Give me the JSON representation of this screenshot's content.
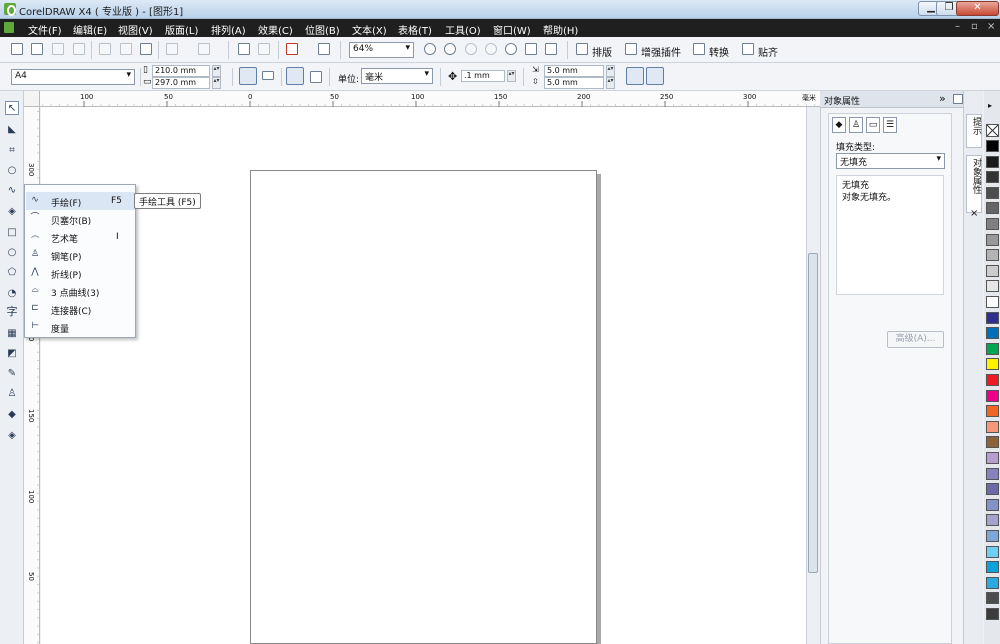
{
  "window": {
    "title": "CorelDRAW X4 ( 专业版 ) - [图形1]",
    "controls": [
      "▁",
      "❐",
      "✕"
    ]
  },
  "menu": [
    "文件(F)",
    "编辑(E)",
    "视图(V)",
    "版面(L)",
    "排列(A)",
    "效果(C)",
    "位图(B)",
    "文本(X)",
    "表格(T)",
    "工具(O)",
    "窗口(W)",
    "帮助(H)"
  ],
  "menu_right": [
    "–",
    "▫",
    "×"
  ],
  "toolbar": {
    "zoom": "64%",
    "plugins": [
      "排版",
      "增强插件",
      "转换",
      "贴齐"
    ]
  },
  "property_bar": {
    "page_size": "A4",
    "width": "210.0 mm",
    "height": "297.0 mm",
    "unit_label": "单位:",
    "unit_value": "毫米",
    "nudge": ".1 mm",
    "dup_x": "5.0 mm",
    "dup_y": "5.0 mm"
  },
  "ruler": {
    "h_ticks": [
      "100",
      "50",
      "0",
      "50",
      "100",
      "150",
      "200",
      "250",
      "300",
      "毫米"
    ],
    "v_ticks": [
      "300",
      "250",
      "200",
      "150",
      "100",
      "50"
    ]
  },
  "toolbox_text": "字",
  "flyout": {
    "items": [
      {
        "label": "手绘(F)",
        "key": "F5",
        "icon": "freehand-icon"
      },
      {
        "label": "贝塞尔(B)",
        "key": "",
        "icon": "bezier-icon"
      },
      {
        "label": "艺术笔",
        "key": "I",
        "icon": "artistic-media-icon"
      },
      {
        "label": "钢笔(P)",
        "key": "",
        "icon": "pen-icon"
      },
      {
        "label": "折线(P)",
        "key": "",
        "icon": "polyline-icon"
      },
      {
        "label": "3 点曲线(3)",
        "key": "",
        "icon": "3-point-curve-icon"
      },
      {
        "label": "连接器(C)",
        "key": "",
        "icon": "connector-icon"
      },
      {
        "label": "度量",
        "key": "",
        "icon": "dimension-icon"
      }
    ]
  },
  "tooltip": "手绘工具 (F5)",
  "docker": {
    "title": "对象属性",
    "fill_type_label": "填充类型:",
    "fill_type_value": "无填充",
    "info_title": "无填充",
    "info_text": "对象无填充。",
    "advanced_button": "高级(A)...",
    "vertical_tabs": [
      "提示",
      "对象属性"
    ]
  },
  "palette_colors": [
    "#ffffff",
    "#000000",
    "#1a1a1a",
    "#333333",
    "#4d4d4d",
    "#666666",
    "#808080",
    "#999999",
    "#b3b3b3",
    "#cccccc",
    "#e6e6e6",
    "#ffffff",
    "#2e2f8f",
    "#0070b8",
    "#00a651",
    "#fff200",
    "#ed1c24",
    "#ec008c",
    "#f26522",
    "#f7977a",
    "#8c6239",
    "#b79ed0",
    "#8781bd",
    "#6a6aa8",
    "#8393ca",
    "#a3a3cc",
    "#7da7d9",
    "#6dcff6",
    "#0aa3db",
    "#29abe2",
    "#4d4d4d",
    "#3c3c3c"
  ]
}
